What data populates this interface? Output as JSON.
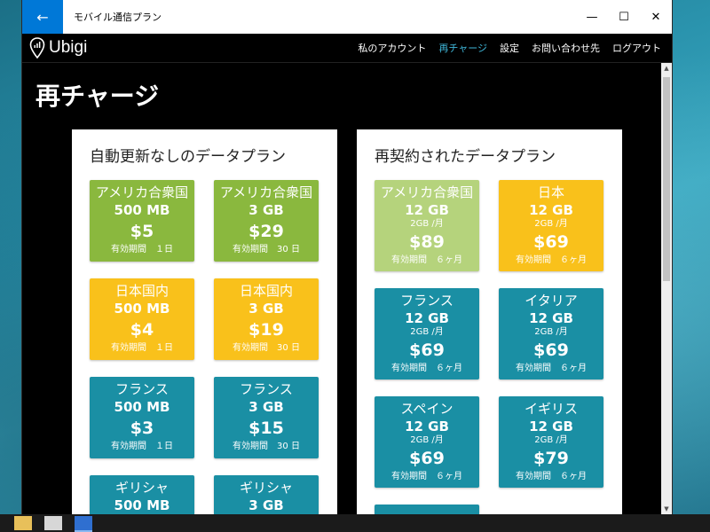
{
  "window": {
    "title": "モバイル通信プラン",
    "back_icon": "←",
    "min_icon": "—",
    "max_icon": "☐",
    "close_icon": "✕"
  },
  "app": {
    "logo": "Ubigi"
  },
  "nav": {
    "items": [
      {
        "label": "私のアカウント",
        "active": false
      },
      {
        "label": "再チャージ",
        "active": true
      },
      {
        "label": "設定",
        "active": false
      },
      {
        "label": "お問い合わせ先",
        "active": false
      },
      {
        "label": "ログアウト",
        "active": false
      }
    ]
  },
  "page": {
    "title": "再チャージ"
  },
  "colors": {
    "green": "#8ab83e",
    "light_green": "#b5d37c",
    "yellow": "#f9c11b",
    "teal": "#1a8fa4",
    "accent": "#3fb6d8"
  },
  "no_renewal": {
    "heading": "自動更新なしのデータプラン",
    "plans": [
      {
        "country": "アメリカ合衆国",
        "size": "500 MB",
        "price": "$5",
        "validity": "有効期間　１日"
      },
      {
        "country": "アメリカ合衆国",
        "size": "3 GB",
        "price": "$29",
        "validity": "有効期間　30 日"
      },
      {
        "country": "日本国内",
        "size": "500 MB",
        "price": "$4",
        "validity": "有効期間　１日"
      },
      {
        "country": "日本国内",
        "size": "3 GB",
        "price": "$19",
        "validity": "有効期間　30 日"
      },
      {
        "country": "フランス",
        "size": "500 MB",
        "price": "$3",
        "validity": "有効期間　１日"
      },
      {
        "country": "フランス",
        "size": "3 GB",
        "price": "$15",
        "validity": "有効期間　30 日"
      },
      {
        "country": "ギリシャ",
        "size": "500 MB",
        "price": "",
        "validity": ""
      },
      {
        "country": "ギリシャ",
        "size": "3 GB",
        "price": "",
        "validity": ""
      }
    ]
  },
  "renewing": {
    "heading": "再契約されたデータプラン",
    "plans": [
      {
        "country": "アメリカ合衆国",
        "size": "12 GB",
        "monthly": "2GB /月",
        "price": "$89",
        "validity": "有効期間　６ヶ月"
      },
      {
        "country": "日本",
        "size": "12 GB",
        "monthly": "2GB /月",
        "price": "$69",
        "validity": "有効期間　６ヶ月"
      },
      {
        "country": "フランス",
        "size": "12 GB",
        "monthly": "2GB /月",
        "price": "$69",
        "validity": "有効期間　６ヶ月"
      },
      {
        "country": "イタリア",
        "size": "12 GB",
        "monthly": "2GB /月",
        "price": "$69",
        "validity": "有効期間　６ヶ月"
      },
      {
        "country": "スペイン",
        "size": "12 GB",
        "monthly": "2GB /月",
        "price": "$69",
        "validity": "有効期間　６ヶ月"
      },
      {
        "country": "イギリス",
        "size": "12 GB",
        "monthly": "2GB /月",
        "price": "$79",
        "validity": "有効期間　６ヶ月"
      }
    ]
  }
}
